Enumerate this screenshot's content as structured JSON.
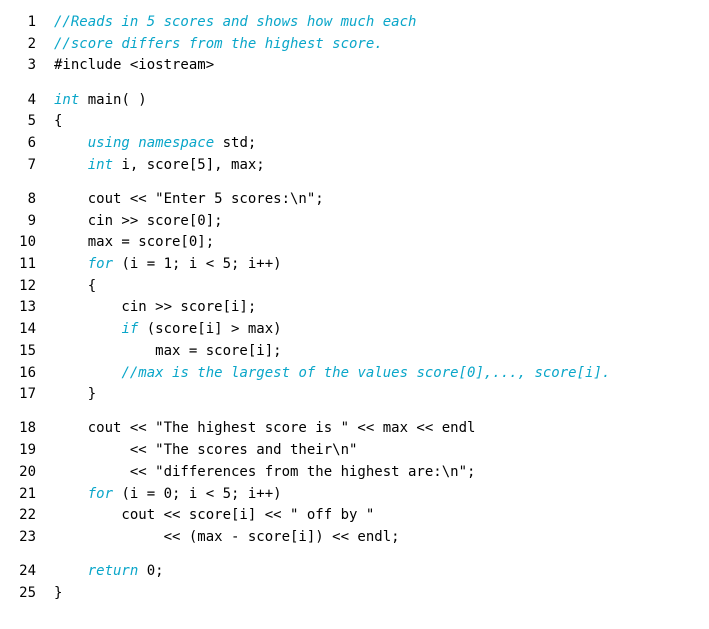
{
  "lines": [
    {
      "n": 1,
      "gap": false,
      "tokens": [
        {
          "cls": "cm",
          "t": "//Reads in 5 scores and shows how much each"
        }
      ]
    },
    {
      "n": 2,
      "gap": false,
      "tokens": [
        {
          "cls": "cm",
          "t": "//score differs from the highest score."
        }
      ]
    },
    {
      "n": 3,
      "gap": false,
      "tokens": [
        {
          "cls": "",
          "t": "#include <iostream>"
        }
      ]
    },
    {
      "n": 4,
      "gap": true,
      "tokens": [
        {
          "cls": "kw",
          "t": "int"
        },
        {
          "cls": "",
          "t": " main( )"
        }
      ]
    },
    {
      "n": 5,
      "gap": false,
      "tokens": [
        {
          "cls": "",
          "t": "{"
        }
      ]
    },
    {
      "n": 6,
      "gap": false,
      "tokens": [
        {
          "cls": "",
          "t": "    "
        },
        {
          "cls": "kw",
          "t": "using namespace"
        },
        {
          "cls": "",
          "t": " std;"
        }
      ]
    },
    {
      "n": 7,
      "gap": false,
      "tokens": [
        {
          "cls": "",
          "t": "    "
        },
        {
          "cls": "kw",
          "t": "int"
        },
        {
          "cls": "",
          "t": " i, score[5], max;"
        }
      ]
    },
    {
      "n": 8,
      "gap": true,
      "tokens": [
        {
          "cls": "",
          "t": "    cout << \"Enter 5 scores:\\n\";"
        }
      ]
    },
    {
      "n": 9,
      "gap": false,
      "tokens": [
        {
          "cls": "",
          "t": "    cin >> score[0];"
        }
      ]
    },
    {
      "n": 10,
      "gap": false,
      "tokens": [
        {
          "cls": "",
          "t": "    max = score[0];"
        }
      ]
    },
    {
      "n": 11,
      "gap": false,
      "tokens": [
        {
          "cls": "",
          "t": "    "
        },
        {
          "cls": "kw",
          "t": "for"
        },
        {
          "cls": "",
          "t": " (i = 1; i < 5; i++)"
        }
      ]
    },
    {
      "n": 12,
      "gap": false,
      "tokens": [
        {
          "cls": "",
          "t": "    {"
        }
      ]
    },
    {
      "n": 13,
      "gap": false,
      "tokens": [
        {
          "cls": "",
          "t": "        cin >> score[i];"
        }
      ]
    },
    {
      "n": 14,
      "gap": false,
      "tokens": [
        {
          "cls": "",
          "t": "        "
        },
        {
          "cls": "kw",
          "t": "if"
        },
        {
          "cls": "",
          "t": " (score[i] > max)"
        }
      ]
    },
    {
      "n": 15,
      "gap": false,
      "tokens": [
        {
          "cls": "",
          "t": "            max = score[i];"
        }
      ]
    },
    {
      "n": 16,
      "gap": false,
      "tokens": [
        {
          "cls": "",
          "t": "        "
        },
        {
          "cls": "cm",
          "t": "//max is the largest of the values score[0],..., score[i]."
        }
      ]
    },
    {
      "n": 17,
      "gap": false,
      "tokens": [
        {
          "cls": "",
          "t": "    }"
        }
      ]
    },
    {
      "n": 18,
      "gap": true,
      "tokens": [
        {
          "cls": "",
          "t": "    cout << \"The highest score is \" << max << endl"
        }
      ]
    },
    {
      "n": 19,
      "gap": false,
      "tokens": [
        {
          "cls": "",
          "t": "         << \"The scores and their\\n\""
        }
      ]
    },
    {
      "n": 20,
      "gap": false,
      "tokens": [
        {
          "cls": "",
          "t": "         << \"differences from the highest are:\\n\";"
        }
      ]
    },
    {
      "n": 21,
      "gap": false,
      "tokens": [
        {
          "cls": "",
          "t": "    "
        },
        {
          "cls": "kw",
          "t": "for"
        },
        {
          "cls": "",
          "t": " (i = 0; i < 5; i++)"
        }
      ]
    },
    {
      "n": 22,
      "gap": false,
      "tokens": [
        {
          "cls": "",
          "t": "        cout << score[i] << \" off by \""
        }
      ]
    },
    {
      "n": 23,
      "gap": false,
      "tokens": [
        {
          "cls": "",
          "t": "             << (max - score[i]) << endl;"
        }
      ]
    },
    {
      "n": 24,
      "gap": true,
      "tokens": [
        {
          "cls": "",
          "t": "    "
        },
        {
          "cls": "kw",
          "t": "return"
        },
        {
          "cls": "",
          "t": " 0;"
        }
      ]
    },
    {
      "n": 25,
      "gap": false,
      "tokens": [
        {
          "cls": "",
          "t": "}"
        }
      ]
    }
  ]
}
